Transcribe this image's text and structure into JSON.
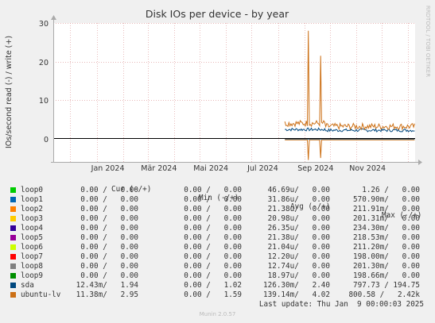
{
  "chart_data": {
    "type": "line",
    "title": "Disk IOs per device - by year",
    "ylabel": "IOs/second read (-) / write (+)",
    "side_label": "RRDTOOL / TOBI OETIKER",
    "ylim": [
      -6,
      30
    ],
    "y_ticks": [
      0,
      10,
      20,
      30
    ],
    "x_tick_labels": [
      "Jan 2024",
      "Mär 2024",
      "Mai 2024",
      "Jul 2024",
      "Sep 2024",
      "Nov 2024"
    ],
    "grid": true,
    "series": [
      {
        "name": "sda",
        "color": "#00487f",
        "write_base": 2.4,
        "read_base": -0.1,
        "spikes": []
      },
      {
        "name": "ubuntu-lv",
        "color": "#cc7016",
        "write_base": 4.0,
        "read_base": -0.3,
        "spikes": [
          {
            "date": "Sep 6 2024",
            "write": 28,
            "read": -5.5
          },
          {
            "date": "Sep 20 2024",
            "write": 21.5,
            "read": -5.0
          }
        ]
      }
    ]
  },
  "legend": {
    "headers": {
      "cur": "Cur (-/+)",
      "min": "Min (-/+)",
      "avg": "Avg (-/+)",
      "max": "Max (-/+)"
    },
    "rows": [
      {
        "name": "loop0",
        "color": "#00cc00",
        "cur": "0.00 /   0.00",
        "min": "0.00 /   0.00",
        "avg": "46.69u/   0.00",
        "max": "1.26 /   0.00"
      },
      {
        "name": "loop1",
        "color": "#0066b3",
        "cur": "0.00 /   0.00",
        "min": "0.00 /   0.00",
        "avg": "31.86u/   0.00",
        "max": "570.90m/   0.00"
      },
      {
        "name": "loop2",
        "color": "#ff8000",
        "cur": "0.00 /   0.00",
        "min": "0.00 /   0.00",
        "avg": "21.38u/   0.00",
        "max": "211.91m/   0.00"
      },
      {
        "name": "loop3",
        "color": "#ffcc00",
        "cur": "0.00 /   0.00",
        "min": "0.00 /   0.00",
        "avg": "20.98u/   0.00",
        "max": "201.31m/   0.00"
      },
      {
        "name": "loop4",
        "color": "#330099",
        "cur": "0.00 /   0.00",
        "min": "0.00 /   0.00",
        "avg": "26.35u/   0.00",
        "max": "234.30m/   0.00"
      },
      {
        "name": "loop5",
        "color": "#990099",
        "cur": "0.00 /   0.00",
        "min": "0.00 /   0.00",
        "avg": "21.38u/   0.00",
        "max": "218.53m/   0.00"
      },
      {
        "name": "loop6",
        "color": "#ccff00",
        "cur": "0.00 /   0.00",
        "min": "0.00 /   0.00",
        "avg": "21.04u/   0.00",
        "max": "211.20m/   0.00"
      },
      {
        "name": "loop7",
        "color": "#ff0000",
        "cur": "0.00 /   0.00",
        "min": "0.00 /   0.00",
        "avg": "12.20u/   0.00",
        "max": "198.00m/   0.00"
      },
      {
        "name": "loop8",
        "color": "#808080",
        "cur": "0.00 /   0.00",
        "min": "0.00 /   0.00",
        "avg": "12.74u/   0.00",
        "max": "201.30m/   0.00"
      },
      {
        "name": "loop9",
        "color": "#008f00",
        "cur": "0.00 /   0.00",
        "min": "0.00 /   0.00",
        "avg": "18.97u/   0.00",
        "max": "198.66m/   0.00"
      },
      {
        "name": "sda",
        "color": "#00487f",
        "cur": "12.43m/   1.94",
        "min": "0.00 /   1.02",
        "avg": "126.30m/   2.40",
        "max": "797.73 / 194.75"
      },
      {
        "name": "ubuntu-lv",
        "color": "#cc7016",
        "cur": "11.38m/   2.95",
        "min": "0.00 /   1.59",
        "avg": "139.14m/   4.02",
        "max": "800.58 /   2.42k"
      }
    ]
  },
  "last_update": "Last update: Thu Jan  9 00:00:03 2025",
  "footer": "Munin 2.0.57"
}
